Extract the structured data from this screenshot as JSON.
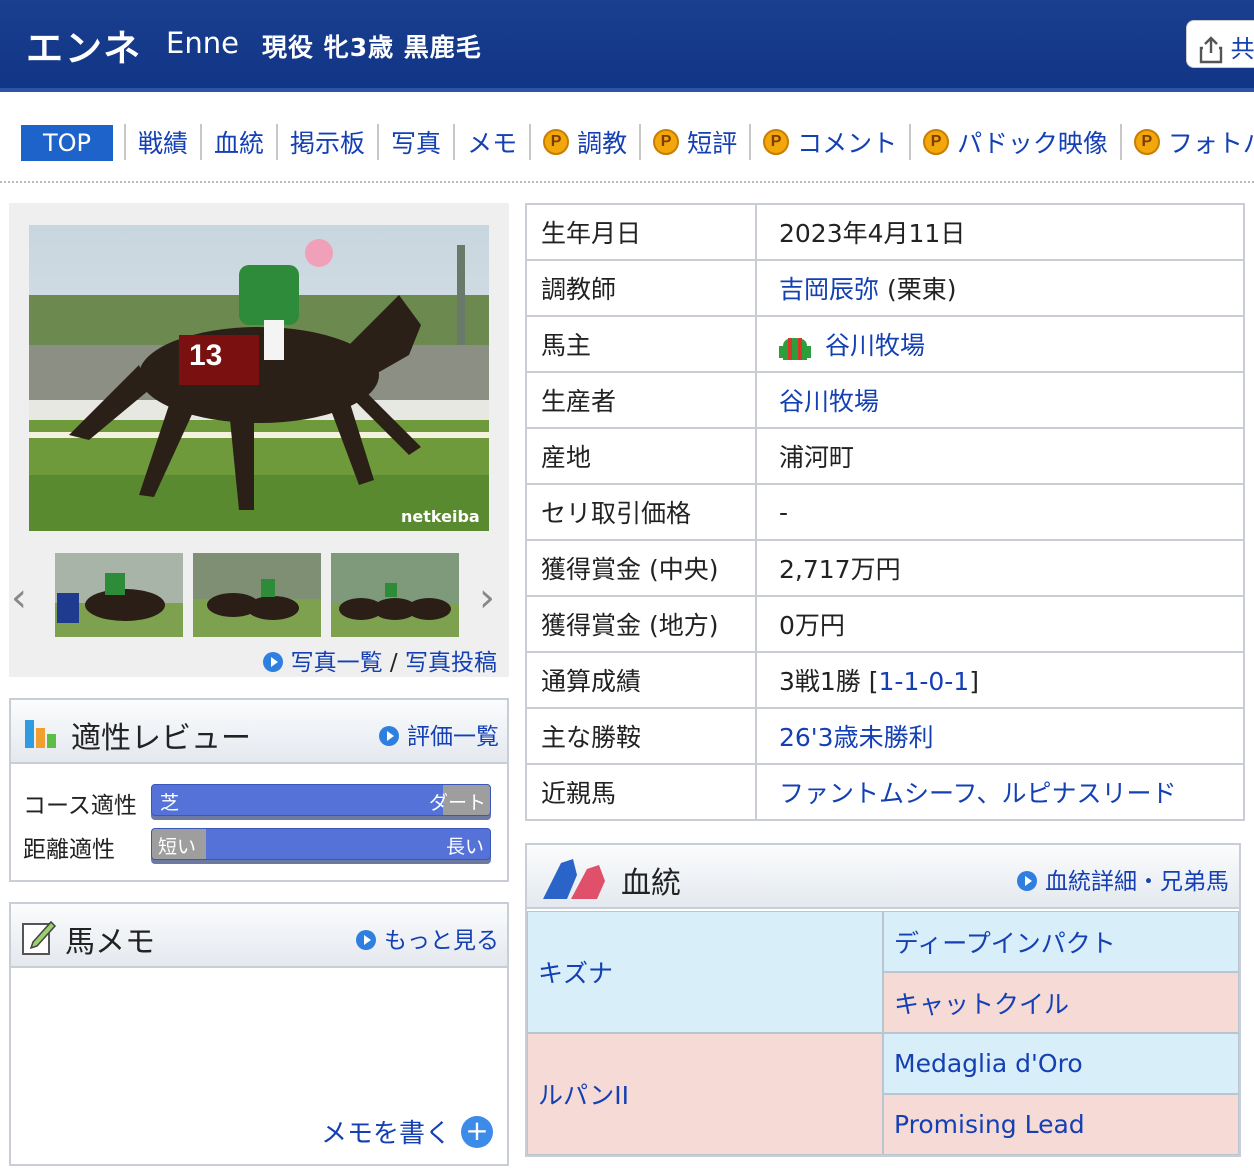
{
  "header": {
    "name_ja": "エンネ",
    "name_en": "Enne",
    "info": "現役 牝3歳 黒鹿毛",
    "share_label": "共"
  },
  "nav": {
    "top": "TOP",
    "items": [
      {
        "label": "戦績",
        "premium": false
      },
      {
        "label": "血統",
        "premium": false
      },
      {
        "label": "掲示板",
        "premium": false
      },
      {
        "label": "写真",
        "premium": false
      },
      {
        "label": "メモ",
        "premium": false
      },
      {
        "label": "調教",
        "premium": true
      },
      {
        "label": "短評",
        "premium": true
      },
      {
        "label": "コメント",
        "premium": true
      },
      {
        "label": "パドック映像",
        "premium": true
      },
      {
        "label": "フォトパ",
        "premium": true
      }
    ],
    "premium_icon_text": "P"
  },
  "photo": {
    "watermark": "netkeiba",
    "bib_number": "13",
    "links": {
      "list": "写真一覧",
      "sep": " / ",
      "post": "写真投稿"
    }
  },
  "aptitude": {
    "title": "適性レビュー",
    "link": "評価一覧",
    "rows": [
      {
        "label": "コース適性",
        "left": "芝",
        "right": "ダート",
        "level": 0.86
      },
      {
        "label": "距離適性",
        "left": "短い",
        "right": "長い",
        "level": 0.16
      }
    ]
  },
  "memo": {
    "title": "馬メモ",
    "link": "もっと見る",
    "write": "メモを書く"
  },
  "profile": {
    "rows": [
      {
        "key": "生年月日",
        "value": "2023年4月11日"
      },
      {
        "key": "調教師",
        "value_link": "吉岡辰弥",
        "value_suffix": " (栗東)"
      },
      {
        "key": "馬主",
        "value_link": "谷川牧場"
      },
      {
        "key": "生産者",
        "value_link": "谷川牧場"
      },
      {
        "key": "産地",
        "value": "浦河町"
      },
      {
        "key": "セリ取引価格",
        "value": "-"
      },
      {
        "key": "獲得賞金 (中央)",
        "value": "2,717万円"
      },
      {
        "key": "獲得賞金 (地方)",
        "value": "0万円"
      },
      {
        "key": "通算成績",
        "value": "3戦1勝 [",
        "value_link": "1-1-0-1",
        "value_suffix": "]"
      },
      {
        "key": "主な勝鞍",
        "value_link": "26'3歳未勝利"
      },
      {
        "key": "近親馬",
        "value_link": "ファントムシーフ、ルピナスリード"
      }
    ]
  },
  "pedigree": {
    "title": "血統",
    "link": "血統詳細・兄弟馬",
    "sire": "キズナ",
    "dam": "ルパンII",
    "sire_sire": "ディープインパクト",
    "sire_dam": "キャットクイル",
    "dam_sire": "Medaglia d'Oro",
    "dam_dam": "Promising Lead"
  }
}
